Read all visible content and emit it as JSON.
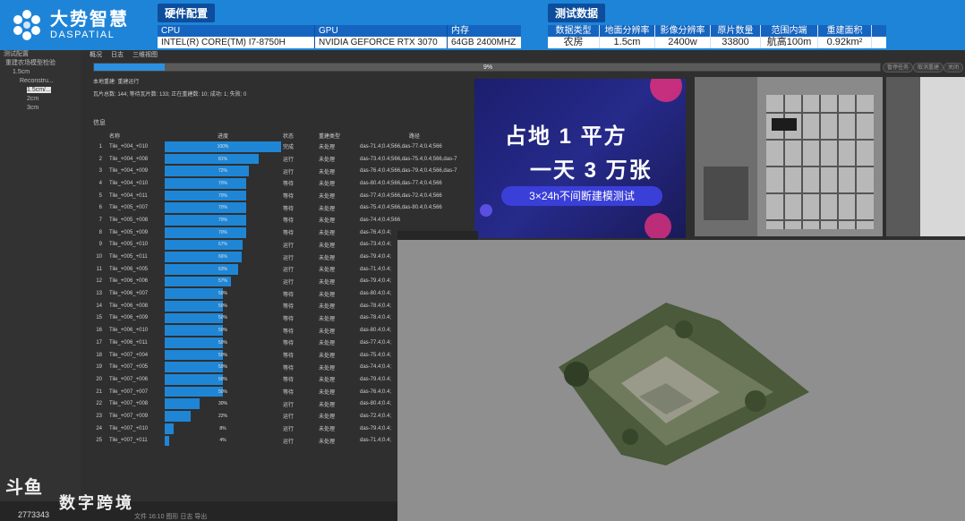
{
  "brand": {
    "cn": "大势智慧",
    "en": "DASPATIAL"
  },
  "hardware": {
    "title": "硬件配置",
    "headers": [
      "CPU",
      "GPU",
      "内存"
    ],
    "values": [
      "INTEL(R) CORE(TM) I7-8750H",
      "NVIDIA GEFORCE RTX 3070",
      "64GB 2400MHZ"
    ]
  },
  "test": {
    "title": "测试数据",
    "headers": [
      "数据类型",
      "地面分辨率",
      "影像分辨率",
      "原片数量",
      "范围内端",
      "重建面积"
    ],
    "values": [
      "农房",
      "1.5cm",
      "2400w",
      "33800",
      "航高100m",
      "0.92km²"
    ]
  },
  "tree": {
    "items": [
      "测试配置",
      "重建农场模型检验",
      "1.5cm",
      "Reconstru...",
      "1.5cm/...",
      "2cm",
      "3cm"
    ]
  },
  "tabs": [
    "概况",
    "日志",
    "三维视图"
  ],
  "progress": {
    "percent": 0.09,
    "label": "9%"
  },
  "buttons": {
    "pause": "暂停任务",
    "stop": "取消重建",
    "close": "关闭"
  },
  "status": {
    "line1": "本地重建: 重建运行",
    "line2": "瓦片总数: 144; 等待瓦片数: 133; 正在重建数: 10; 成功: 1; 失败: 0"
  },
  "table": {
    "label": "信息",
    "headers": [
      "名称",
      "进度",
      "状态",
      "重建类型",
      "路径"
    ],
    "rows": [
      {
        "idx": "1",
        "name": "Tile_+004_+010",
        "progress": 1.0,
        "ptxt": "100%",
        "status": "完成",
        "type": "未处理",
        "path": "das-71.4;0.4;566,das-77.4;0.4;566"
      },
      {
        "idx": "2",
        "name": "Tile_+004_+008",
        "progress": 0.81,
        "ptxt": "81%",
        "status": "运行",
        "type": "未处理",
        "path": "das-73.4;0.4;566,das-75.4;0.4;566,das-7"
      },
      {
        "idx": "3",
        "name": "Tile_+004_+009",
        "progress": 0.72,
        "ptxt": "72%",
        "status": "运行",
        "type": "未处理",
        "path": "das-76.4;0.4;566,das-79.4;0.4;566,das-7"
      },
      {
        "idx": "4",
        "name": "Tile_+004_+010",
        "progress": 0.7,
        "ptxt": "70%",
        "status": "等待",
        "type": "未处理",
        "path": "das-80.4;0.4;566,das-77.4;0.4;566"
      },
      {
        "idx": "5",
        "name": "Tile_+004_+011",
        "progress": 0.7,
        "ptxt": "70%",
        "status": "等待",
        "type": "未处理",
        "path": "das-77.4;0.4;566,das-72.4;0.4;566"
      },
      {
        "idx": "6",
        "name": "Tile_+005_+007",
        "progress": 0.7,
        "ptxt": "70%",
        "status": "等待",
        "type": "未处理",
        "path": "das-75.4;0.4;566,das-80.4;0.4;566"
      },
      {
        "idx": "7",
        "name": "Tile_+005_+008",
        "progress": 0.7,
        "ptxt": "70%",
        "status": "等待",
        "type": "未处理",
        "path": "das-74.4;0.4;566"
      },
      {
        "idx": "8",
        "name": "Tile_+005_+009",
        "progress": 0.7,
        "ptxt": "70%",
        "status": "等待",
        "type": "未处理",
        "path": "das-76.4;0.4;"
      },
      {
        "idx": "9",
        "name": "Tile_+005_+010",
        "progress": 0.67,
        "ptxt": "67%",
        "status": "运行",
        "type": "未处理",
        "path": "das-73.4;0.4;"
      },
      {
        "idx": "10",
        "name": "Tile_+005_+011",
        "progress": 0.66,
        "ptxt": "66%",
        "status": "运行",
        "type": "未处理",
        "path": "das-79.4;0.4;"
      },
      {
        "idx": "11",
        "name": "Tile_+006_+005",
        "progress": 0.63,
        "ptxt": "63%",
        "status": "运行",
        "type": "未处理",
        "path": "das-71.4;0.4;"
      },
      {
        "idx": "12",
        "name": "Tile_+006_+006",
        "progress": 0.57,
        "ptxt": "57%",
        "status": "运行",
        "type": "未处理",
        "path": "das-79.4;0.4;"
      },
      {
        "idx": "13",
        "name": "Tile_+006_+007",
        "progress": 0.5,
        "ptxt": "50%",
        "status": "等待",
        "type": "未处理",
        "path": "das-80.4;0.4;"
      },
      {
        "idx": "14",
        "name": "Tile_+006_+008",
        "progress": 0.5,
        "ptxt": "50%",
        "status": "等待",
        "type": "未处理",
        "path": "das-78.4;0.4;"
      },
      {
        "idx": "15",
        "name": "Tile_+006_+009",
        "progress": 0.5,
        "ptxt": "50%",
        "status": "等待",
        "type": "未处理",
        "path": "das-78.4;0.4;"
      },
      {
        "idx": "16",
        "name": "Tile_+006_+010",
        "progress": 0.5,
        "ptxt": "50%",
        "status": "等待",
        "type": "未处理",
        "path": "das-80.4;0.4;"
      },
      {
        "idx": "17",
        "name": "Tile_+006_+011",
        "progress": 0.5,
        "ptxt": "50%",
        "status": "等待",
        "type": "未处理",
        "path": "das-77.4;0.4;"
      },
      {
        "idx": "18",
        "name": "Tile_+007_+004",
        "progress": 0.5,
        "ptxt": "50%",
        "status": "等待",
        "type": "未处理",
        "path": "das-75.4;0.4;"
      },
      {
        "idx": "19",
        "name": "Tile_+007_+005",
        "progress": 0.5,
        "ptxt": "50%",
        "status": "等待",
        "type": "未处理",
        "path": "das-74.4;0.4;"
      },
      {
        "idx": "20",
        "name": "Tile_+007_+006",
        "progress": 0.5,
        "ptxt": "50%",
        "status": "等待",
        "type": "未处理",
        "path": "das-79.4;0.4;"
      },
      {
        "idx": "21",
        "name": "Tile_+007_+007",
        "progress": 0.5,
        "ptxt": "50%",
        "status": "等待",
        "type": "未处理",
        "path": "das-76.4;0.4;"
      },
      {
        "idx": "22",
        "name": "Tile_+007_+008",
        "progress": 0.3,
        "ptxt": "30%",
        "status": "运行",
        "type": "未处理",
        "path": "das-80.4;0.4;"
      },
      {
        "idx": "23",
        "name": "Tile_+007_+009",
        "progress": 0.22,
        "ptxt": "22%",
        "status": "运行",
        "type": "未处理",
        "path": "das-72.4;0.4;"
      },
      {
        "idx": "24",
        "name": "Tile_+007_+010",
        "progress": 0.08,
        "ptxt": "8%",
        "status": "运行",
        "type": "未处理",
        "path": "das-79.4;0.4;"
      },
      {
        "idx": "25",
        "name": "Tile_+007_+011",
        "progress": 0.04,
        "ptxt": "4%",
        "status": "运行",
        "type": "未处理",
        "path": "das-71.4;0.4;"
      }
    ]
  },
  "promo": {
    "line1": "占地 1 平方",
    "line2": "一天 3 万张",
    "tag": "3×24h不间断建模测试"
  },
  "watermark": {
    "mark": "斗鱼",
    "site": "数字跨境",
    "id": "2773343"
  },
  "footer_text": "文件 16:10 图形 日志 导出",
  "colors": {
    "banner": "#1e84d8",
    "bar": "#1f86d6",
    "promo_bg": "#262a8a"
  }
}
